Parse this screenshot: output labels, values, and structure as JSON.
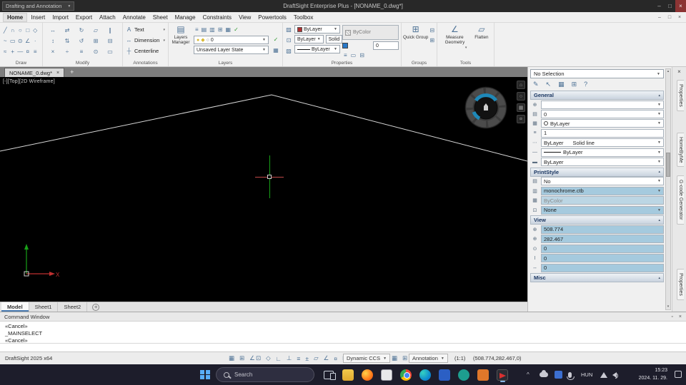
{
  "colors": {
    "canvas_bg": "#000000",
    "highlight_blue": "#a5cade",
    "titlebar_bg": "#282828",
    "taskbar_bg": "#1d1d2b",
    "crosshair_x_red": "#c04848",
    "crosshair_y_green": "#18a018"
  },
  "glyphs": {
    "dropdown": "▾",
    "combo_arrow": "▼",
    "close": "×",
    "plus": "+",
    "check": "✓",
    "collapse_arrow": "▴",
    "minimize": "–",
    "maximize": "□",
    "pin": "▫",
    "scroll_up": "▴",
    "scroll_down": "▾",
    "tray_chevron": "^"
  },
  "titlebar": {
    "workspace_selector": "Drafting and Annotation",
    "title": "DraftSight Enterprise Plus - [NONAME_0.dwg*]"
  },
  "menubar": {
    "items": [
      "Home",
      "Insert",
      "Import",
      "Export",
      "Attach",
      "Annotate",
      "Sheet",
      "Manage",
      "Constraints",
      "View",
      "Powertools",
      "Toolbox"
    ]
  },
  "ribbon": {
    "group_labels": [
      "Draw",
      "Modify",
      "Annotations",
      "Layers",
      "Properties",
      "Groups",
      "Tools"
    ],
    "draw_icons": [
      "╱",
      "∩",
      "○",
      "□",
      "◇",
      "~",
      "▭",
      "⊙",
      "∠",
      "·",
      "≈",
      "+",
      "—",
      "¤",
      "≡"
    ],
    "modify_icons": [
      "↔",
      "⇄",
      "↻",
      "▱",
      "∥",
      "↕",
      "⇅",
      "↺",
      "⊞",
      "⊟",
      "×",
      "÷",
      "≡",
      "⊙",
      "▭"
    ],
    "annotations": {
      "text_icon": "A",
      "text_label": "Text",
      "dimension_icon": "↔",
      "dimension_label": "Dimension",
      "centerline_icon": "┼",
      "centerline_label": "Centerline"
    },
    "layers": {
      "manager_icon": "▤",
      "manager_label": "Layers Manager",
      "tool_icons": [
        "≡",
        "▤",
        "▥",
        "⊞",
        "▦",
        "✓"
      ],
      "status_icons": [
        "●",
        "◆",
        "○"
      ],
      "active_layer": "0",
      "layer_state": "Unsaved Layer State",
      "preview_icon": "▦"
    },
    "properties": {
      "col_icons": [
        "▨",
        "⊡",
        "▧"
      ],
      "color_value": "ByLayer",
      "bycolor_value": "ByColor",
      "linetype_value": "ByLayer",
      "fill_value": "Solid",
      "lineweight_value": "ByLayer",
      "thickness_value": "0",
      "row3_icons": [
        "≡",
        "▭",
        "⊟"
      ]
    },
    "groups": {
      "icon": "⊞",
      "quick_group_label": "Quick Group",
      "side_icons": [
        "⊟",
        "⊞"
      ]
    },
    "tools": {
      "measure_icon": "∠",
      "measure_label": "Measure Geometry",
      "flatten_icon": "▱",
      "flatten_label": "Flatten"
    }
  },
  "document_tabs": {
    "active_tab": "NONAME_0.dwg*"
  },
  "canvas": {
    "viewport_label": "[-][Top][2D Wireframe]",
    "ucs_x_label": "X",
    "viewport_control_icons": [
      "⌂",
      "○",
      "▦",
      "¤"
    ]
  },
  "sheet_tabs": {
    "tabs": [
      "Model",
      "Sheet1",
      "Sheet2"
    ]
  },
  "properties_panel": {
    "selection_value": "No Selection",
    "toolbar_icons": [
      "✎",
      "↖",
      "▦",
      "⊞",
      "?"
    ],
    "sections": {
      "general": {
        "title": "General",
        "icons": [
          "⊕",
          "▤",
          "▦",
          "≡",
          "⋯",
          "—",
          "▬"
        ],
        "rows": [
          {
            "value": ""
          },
          {
            "value": "0"
          },
          {
            "value": "ByLayer"
          },
          {
            "value": "1"
          },
          {
            "value": "ByLayer",
            "value2": "Solid line"
          },
          {
            "value": "ByLayer"
          },
          {
            "value": "ByLayer"
          }
        ]
      },
      "printstyle": {
        "title": "PrintStyle",
        "icons": [
          "▤",
          "▥",
          "▦",
          "⊡"
        ],
        "rows": [
          {
            "value": "No"
          },
          {
            "value": "monochrome.ctb"
          },
          {
            "value": "ByColor"
          },
          {
            "value": "None"
          }
        ]
      },
      "view": {
        "title": "View",
        "icons": [
          "⊕",
          "⊕",
          "⊙",
          "I",
          "↔"
        ],
        "rows": [
          {
            "value": "508.774"
          },
          {
            "value": "282.467"
          },
          {
            "value": "0"
          },
          {
            "value": "0"
          },
          {
            "value": "0"
          }
        ]
      },
      "misc": {
        "title": "Misc"
      }
    }
  },
  "side_tabs": {
    "items": [
      "Properties",
      "HomeByMe",
      "G-code Generator",
      "Properties"
    ]
  },
  "command_window": {
    "title": "Command Window",
    "lines": [
      "«Cancel»",
      "_MAINSELECT",
      "«Cancel»"
    ]
  },
  "status_bar": {
    "app_version": "DraftSight 2025 x64",
    "icons_a": [
      "▦",
      "⊞",
      "∠"
    ],
    "icons_b": [
      "⊡",
      "◇",
      "∟",
      "⊥",
      "≡",
      "±",
      "▱",
      "∠",
      "¤",
      "⊞"
    ],
    "ccs_value": "Dynamic CCS",
    "mid_icons": [
      "▦",
      "⊞"
    ],
    "annotation_value": "Annotation",
    "scale": "(1:1)",
    "coordinates": "(508.774,282.467,0)"
  },
  "taskbar": {
    "search_placeholder": "Search",
    "language": "HUN",
    "time": "15:23",
    "date": "2024. 11. 29."
  }
}
